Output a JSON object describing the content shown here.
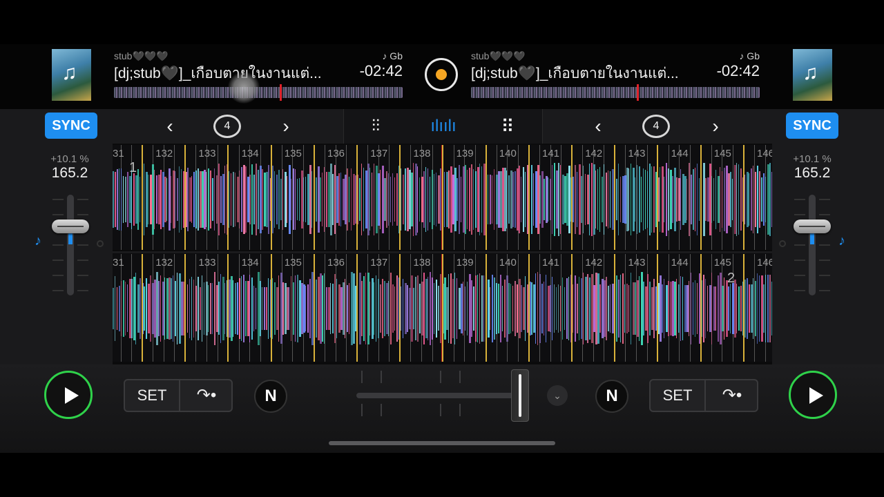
{
  "deck_left": {
    "artist": "stub🖤🖤🖤",
    "title": "[dj;stub🖤]_เกือบตายในงานแต่...",
    "key": "♪ Gb",
    "time_remaining": "-02:42",
    "sync_label": "SYNC",
    "pitch": "+10.1 %",
    "bpm": "165.2",
    "loop_beats": "4",
    "cue_set_label": "SET",
    "deck_number": "1"
  },
  "deck_right": {
    "artist": "stub🖤🖤🖤",
    "title": "[dj;stub🖤]_เกือบตายในงานแต่...",
    "key": "♪ Gb",
    "time_remaining": "-02:42",
    "sync_label": "SYNC",
    "pitch": "+10.1 %",
    "bpm": "165.2",
    "loop_beats": "4",
    "cue_set_label": "SET",
    "deck_number": "2"
  },
  "bar_numbers": [
    "31",
    "132",
    "133",
    "134",
    "135",
    "136",
    "137",
    "138",
    "139",
    "140",
    "141",
    "142",
    "143",
    "144",
    "145",
    "146"
  ],
  "icons": {
    "record": "record-icon",
    "prev": "chevron-left-icon",
    "next": "chevron-right-icon",
    "loop": "loop-icon",
    "mixer": "mixer-icon",
    "waveform": "waveform-icon",
    "grid": "grid-icon",
    "eq": "eq-icon",
    "play": "play-icon",
    "jump": "jump-icon",
    "neural": "neural-mix-icon"
  },
  "colors": {
    "accent": "#1e8ef0",
    "play": "#2fd24a",
    "playhead": "#e0222a",
    "record": "#f5a623"
  }
}
